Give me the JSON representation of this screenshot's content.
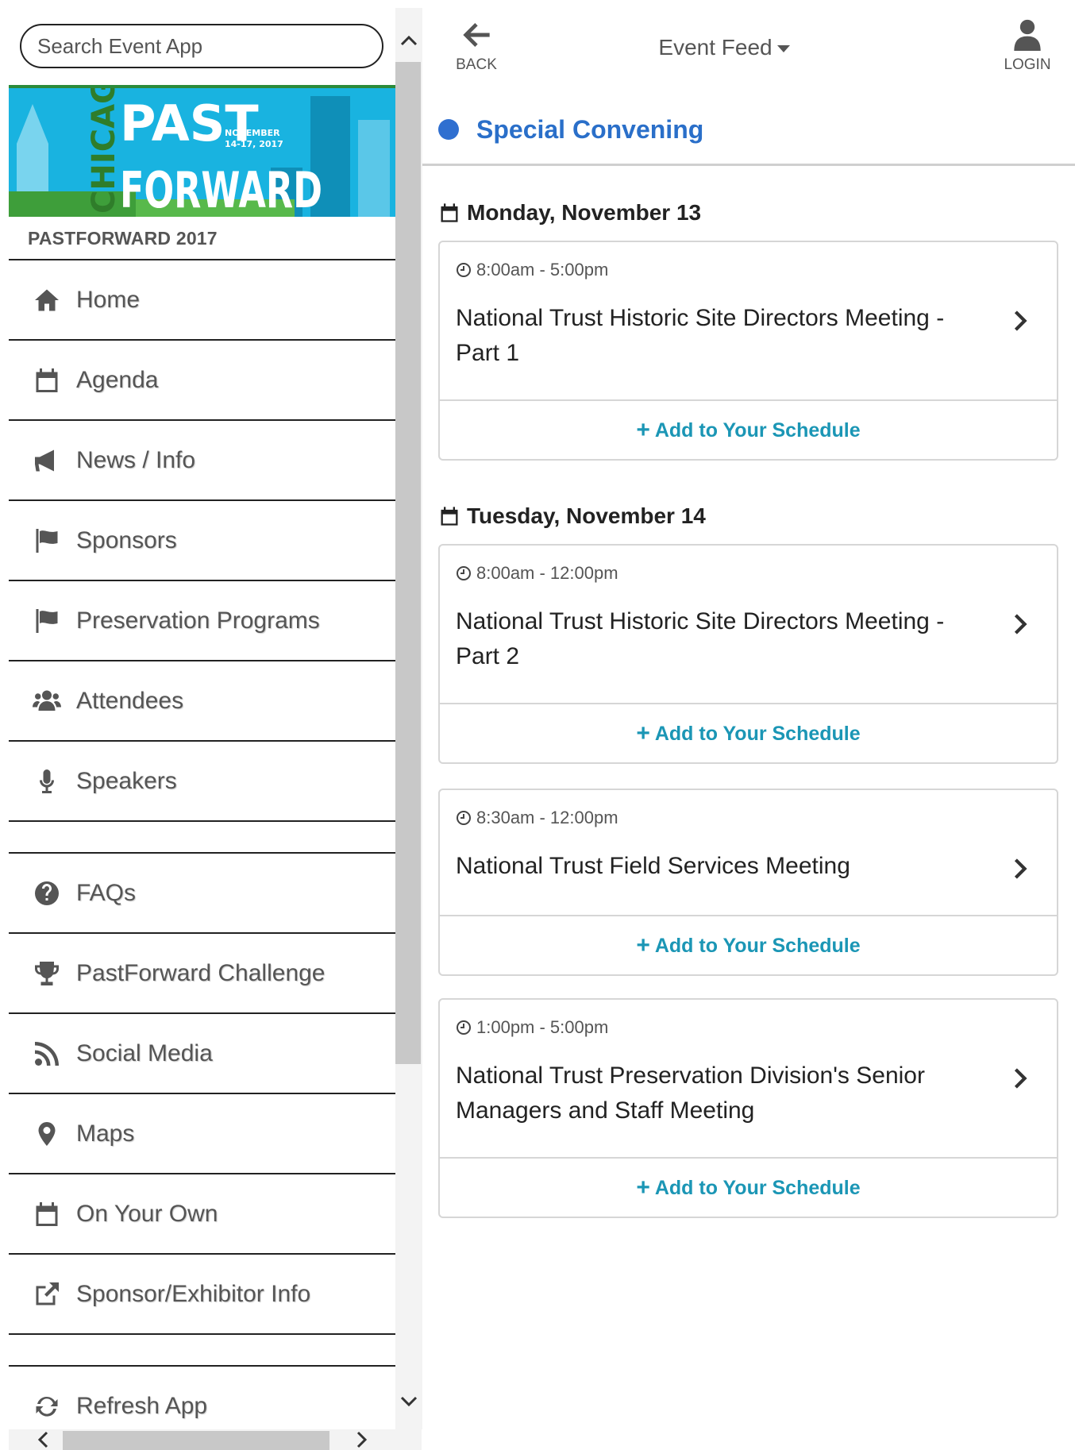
{
  "sidebar": {
    "search_placeholder": "Search Event App",
    "banner": {
      "line1": "PAST",
      "line2": "FORWARD",
      "city": "CHICAGO",
      "date_line1": "NOVEMBER",
      "date_line2": "14-17, 2017"
    },
    "event_name": "PASTFORWARD 2017",
    "items": [
      {
        "label": "Home",
        "icon": "home-icon"
      },
      {
        "label": "Agenda",
        "icon": "calendar-icon"
      },
      {
        "label": "News / Info",
        "icon": "megaphone-icon"
      },
      {
        "label": "Sponsors",
        "icon": "flag-icon"
      },
      {
        "label": "Preservation Programs",
        "icon": "flag-icon"
      },
      {
        "label": "Attendees",
        "icon": "users-icon"
      },
      {
        "label": "Speakers",
        "icon": "microphone-icon"
      },
      {
        "label": "FAQs",
        "icon": "question-icon"
      },
      {
        "label": "PastForward Challenge",
        "icon": "trophy-icon"
      },
      {
        "label": "Social Media",
        "icon": "rss-icon"
      },
      {
        "label": "Maps",
        "icon": "map-marker-icon"
      },
      {
        "label": "On Your Own",
        "icon": "calendar-icon"
      },
      {
        "label": "Sponsor/Exhibitor Info",
        "icon": "external-link-icon"
      },
      {
        "label": "Refresh App",
        "icon": "refresh-icon"
      }
    ]
  },
  "topbar": {
    "back_label": "BACK",
    "title": "Event Feed",
    "login_label": "LOGIN"
  },
  "section": {
    "title": "Special Convening",
    "dot_color": "#2f6fd0"
  },
  "days": [
    {
      "title": "Monday, November 13",
      "events": [
        {
          "time": "8:00am - 5:00pm",
          "title": "National Trust Historic Site Directors Meeting - Part 1",
          "action": "Add to Your Schedule"
        }
      ]
    },
    {
      "title": "Tuesday, November 14",
      "events": [
        {
          "time": "8:00am - 12:00pm",
          "title": "National Trust Historic Site Directors Meeting - Part 2",
          "action": "Add to Your Schedule"
        },
        {
          "time": "8:30am - 12:00pm",
          "title": "National Trust Field Services Meeting",
          "action": "Add to Your Schedule"
        },
        {
          "time": "1:00pm - 5:00pm",
          "title": "National Trust Preservation Division's Senior Managers and Staff Meeting",
          "action": "Add to Your Schedule"
        }
      ]
    }
  ],
  "colors": {
    "accent_blue": "#2a6fc9",
    "action_teal": "#1b96b5",
    "text_gray": "#555555"
  }
}
